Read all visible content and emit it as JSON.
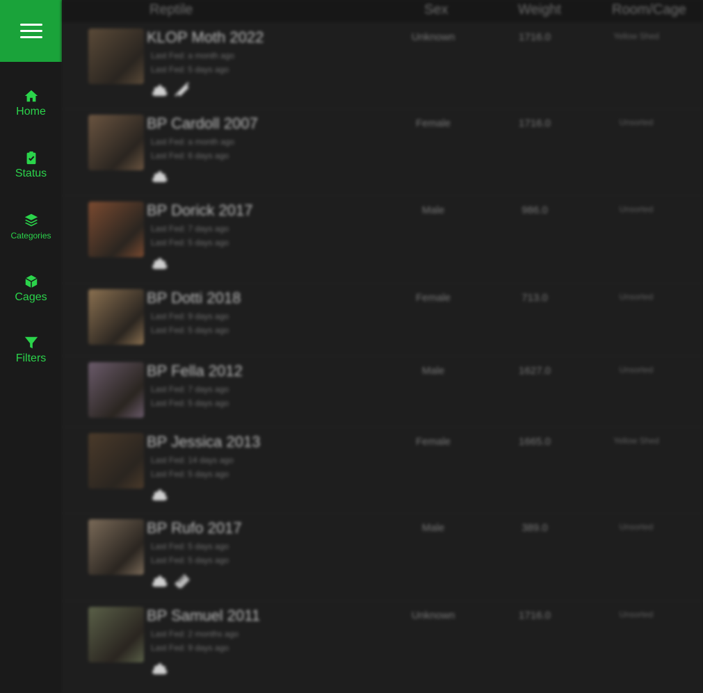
{
  "sidebar": {
    "menu_icon": "hamburger-menu-icon",
    "items": [
      {
        "label": "Home",
        "icon": "home-icon"
      },
      {
        "label": "Status",
        "icon": "clipboard-check-icon"
      },
      {
        "label": "Categories",
        "icon": "layers-icon"
      },
      {
        "label": "Cages",
        "icon": "cube-icon"
      },
      {
        "label": "Filters",
        "icon": "filter-icon"
      }
    ]
  },
  "colors": {
    "accent": "#1aa33a",
    "nav_text": "#2bd44b",
    "background": "#1e1e1e"
  },
  "table": {
    "headers": {
      "reptile": "Reptile",
      "sex": "Sex",
      "weight": "Weight",
      "room": "Room/Cage"
    },
    "rows": [
      {
        "name": "KLOP Moth 2022",
        "line1": "Last Fed: a month ago",
        "line2": "Last Fed: 5 days ago",
        "sex": "Unknown",
        "weight": "1716.0",
        "cage": "Yellow Shed",
        "icons": [
          "poop-icon",
          "syringe-icon"
        ],
        "thumb": "#5a4a38"
      },
      {
        "name": "BP Cardoll 2007",
        "line1": "Last Fed: a month ago",
        "line2": "Last Fed: 6 days ago",
        "sex": "Female",
        "weight": "1716.0",
        "cage": "Unsorted",
        "icons": [
          "poop-icon"
        ],
        "thumb": "#6a5440"
      },
      {
        "name": "BP Dorick 2017",
        "line1": "Last Fed: 7 days ago",
        "line2": "Last Fed: 5 days ago",
        "sex": "Male",
        "weight": "986.0",
        "cage": "Unsorted",
        "icons": [
          "poop-icon"
        ],
        "thumb": "#7a4a30"
      },
      {
        "name": "BP Dotti 2018",
        "line1": "Last Fed: 9 days ago",
        "line2": "Last Fed: 5 days ago",
        "sex": "Female",
        "weight": "713.0",
        "cage": "Unsorted",
        "icons": [],
        "thumb": "#8a7050"
      },
      {
        "name": "BP Fella 2012",
        "line1": "Last Fed: 7 days ago",
        "line2": "Last Fed: 5 days ago",
        "sex": "Male",
        "weight": "1627.0",
        "cage": "Unsorted",
        "icons": [],
        "thumb": "#6a5a6a"
      },
      {
        "name": "BP Jessica 2013",
        "line1": "Last Fed: 14 days ago",
        "line2": "Last Fed: 5 days ago",
        "sex": "Female",
        "weight": "1665.0",
        "cage": "Yellow Shed",
        "icons": [
          "poop-icon"
        ],
        "thumb": "#4a3a2a"
      },
      {
        "name": "BP Rufo 2017",
        "line1": "Last Fed: 5 days ago",
        "line2": "Last Fed: 5 days ago",
        "sex": "Male",
        "weight": "389.0",
        "cage": "Unsorted",
        "icons": [
          "poop-icon",
          "ruler-icon"
        ],
        "thumb": "#7a6a58"
      },
      {
        "name": "BP Samuel 2011",
        "line1": "Last Fed: 2 months ago",
        "line2": "Last Fed: 9 days ago",
        "sex": "Unknown",
        "weight": "1716.0",
        "cage": "Unsorted",
        "icons": [
          "poop-icon"
        ],
        "thumb": "#5a6048"
      }
    ]
  }
}
